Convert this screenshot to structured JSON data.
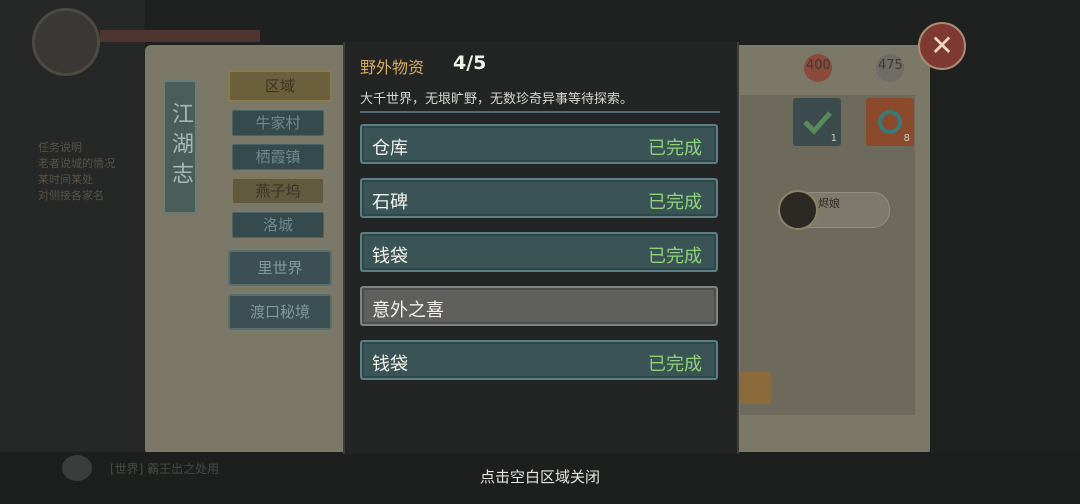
{
  "dialog": {
    "title": "野外物资",
    "count": "4/5",
    "description": "大千世界，无垠旷野，无数珍奇异事等待探索。",
    "items": [
      {
        "name": "仓库",
        "status": "已完成"
      },
      {
        "name": "石碑",
        "status": "已完成"
      },
      {
        "name": "钱袋",
        "status": "已完成"
      },
      {
        "name": "意外之喜",
        "status": ""
      },
      {
        "name": "钱袋",
        "status": "已完成"
      }
    ]
  },
  "hint": "点击空白区域关闭",
  "sidebar": {
    "title": "江湖志",
    "region_tab": "区域",
    "locations": [
      "牛家村",
      "栖霞镇",
      "燕子坞",
      "洛城"
    ],
    "other_tabs": [
      "里世界",
      "渡口秘境"
    ]
  },
  "background": {
    "num_400": "400",
    "num_475": "475",
    "tile_count_1": "1",
    "tile_count_8": "8",
    "avatar_name": "烬娘",
    "chat_text": "[世界] 霸王出之处用",
    "notes": [
      "任务说明",
      "老者说城的情况",
      "某时间某处",
      "对侧接各家名"
    ]
  },
  "colors": {
    "complete_green": "#8ed27a",
    "title_gold": "#d7ad5e",
    "done_item_bg": "#3a5455",
    "pending_item_bg": "#5f5f5e"
  },
  "icons": {
    "close": "close-icon",
    "check": "check-icon",
    "chat": "chat-icon"
  }
}
